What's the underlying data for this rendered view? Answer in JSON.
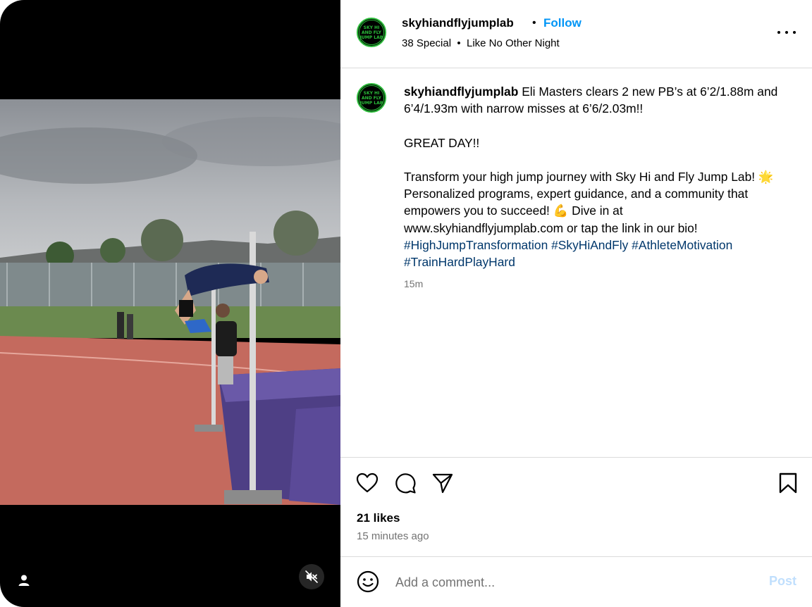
{
  "post": {
    "username": "skyhiandflyjumplab",
    "follow_label": "Follow",
    "header_separator": "•",
    "audio": "38 Special  •  Like No Other Night",
    "avatar_text": [
      "SKY HI AND FLY",
      "JUMP LAB"
    ],
    "more_icon": "more-horizontal-icon"
  },
  "caption": {
    "username": "skyhiandflyjumplab",
    "text_1": " Eli Masters clears 2 new PB’s at 6’2/1.88m and 6’4/1.93m with narrow misses at 6’6/2.03m!!\n\nGREAT DAY!!\n\nTransform your high jump journey with Sky Hi and Fly Jump Lab! 🌟 Personalized programs, expert guidance, and a community that empowers you to succeed! 💪 Dive in at www.skyhiandflyjumplab.com or tap the link in our bio!\n",
    "hashtags": [
      "#HighJumpTransformation",
      "#SkyHiAndFly",
      "#AthleteMotivation",
      "#TrainHardPlayHard"
    ],
    "time": "15m"
  },
  "actions": {
    "like_icon": "heart-icon",
    "comment_icon": "comment-icon",
    "share_icon": "paper-plane-icon",
    "save_icon": "bookmark-icon",
    "likes": "21 likes",
    "posted_ago": "15 minutes ago"
  },
  "comment": {
    "emoji_icon": "smiley-icon",
    "placeholder": "Add a comment...",
    "post_label": "Post"
  },
  "media": {
    "user_tag_icon": "person-icon",
    "mute_icon": "speaker-muted-icon"
  },
  "colors": {
    "accent": "#0095f6",
    "hashtag": "#00376b",
    "muted_text": "#737373",
    "post_disabled": "#c0dffd",
    "avatar_ring": "#2bbd3a"
  }
}
